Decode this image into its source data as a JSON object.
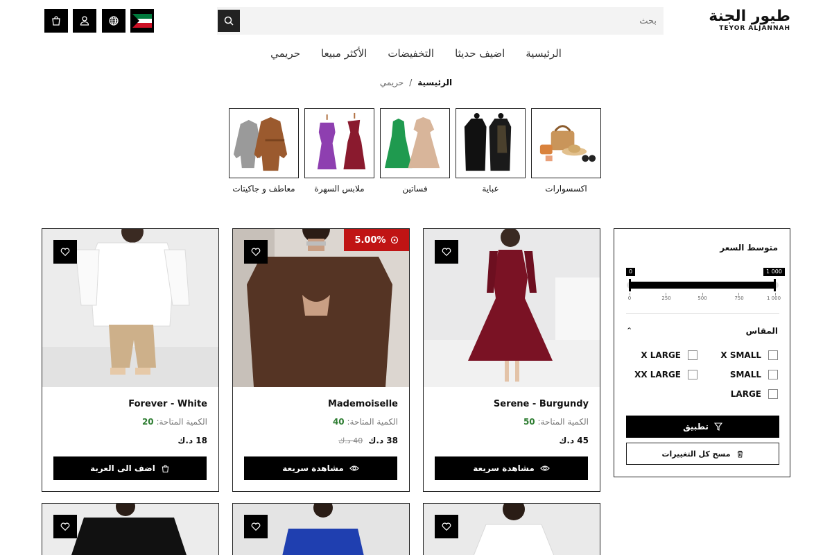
{
  "header": {
    "logo_ar": "طيور الجنة",
    "logo_en": "TEYOR ALJANNAH",
    "search_placeholder": "بحث",
    "icons": [
      "cart-icon",
      "user-icon",
      "globe-icon",
      "kuwait-flag-icon",
      "search-icon"
    ]
  },
  "nav": {
    "items": [
      {
        "label": "الرئيسية"
      },
      {
        "label": "اضيف حديثا"
      },
      {
        "label": "التخفيضات"
      },
      {
        "label": "الأكثر مبيعا"
      },
      {
        "label": "حريمي"
      }
    ]
  },
  "breadcrumb": {
    "home": "الرئيسية",
    "separator": "/",
    "current": "حريمي"
  },
  "categories": [
    {
      "label": "اكسسوارات"
    },
    {
      "label": "عباية"
    },
    {
      "label": "فساتين"
    },
    {
      "label": "ملابس السهرة"
    },
    {
      "label": "معاطف و جاكيتات"
    }
  ],
  "filter": {
    "title": "متوسط السعر",
    "min_label": "0",
    "max_label": "1 000",
    "ticks": [
      "0",
      "250",
      "500",
      "750",
      "1 000"
    ],
    "size_title": "المقاس",
    "sizes": [
      "X SMALL",
      "X LARGE",
      "SMALL",
      "XX LARGE",
      "LARGE"
    ],
    "apply_label": "تطبيق",
    "clear_label": "مسح كل التغييرات"
  },
  "products": [
    {
      "name": "Serene - Burgundy",
      "qty_label": "الكمية المتاحة:",
      "qty": "50",
      "price": "45 د.ك",
      "old_price": "",
      "button": "مشاهدة سريعة",
      "badge": ""
    },
    {
      "name": "Mademoiselle",
      "qty_label": "الكمية المتاحة:",
      "qty": "40",
      "price": "38 د.ك",
      "old_price": "40 د.ك",
      "button": "مشاهدة سريعة",
      "badge": "5.00%"
    },
    {
      "name": "Forever - White",
      "qty_label": "الكمية المتاحة:",
      "qty": "20",
      "price": "18 د.ك",
      "old_price": "",
      "button": "اضف الى العربة",
      "badge": ""
    }
  ],
  "colors": {
    "accent": "#000000",
    "sale": "#c01414",
    "stock": "#2e7d32"
  }
}
